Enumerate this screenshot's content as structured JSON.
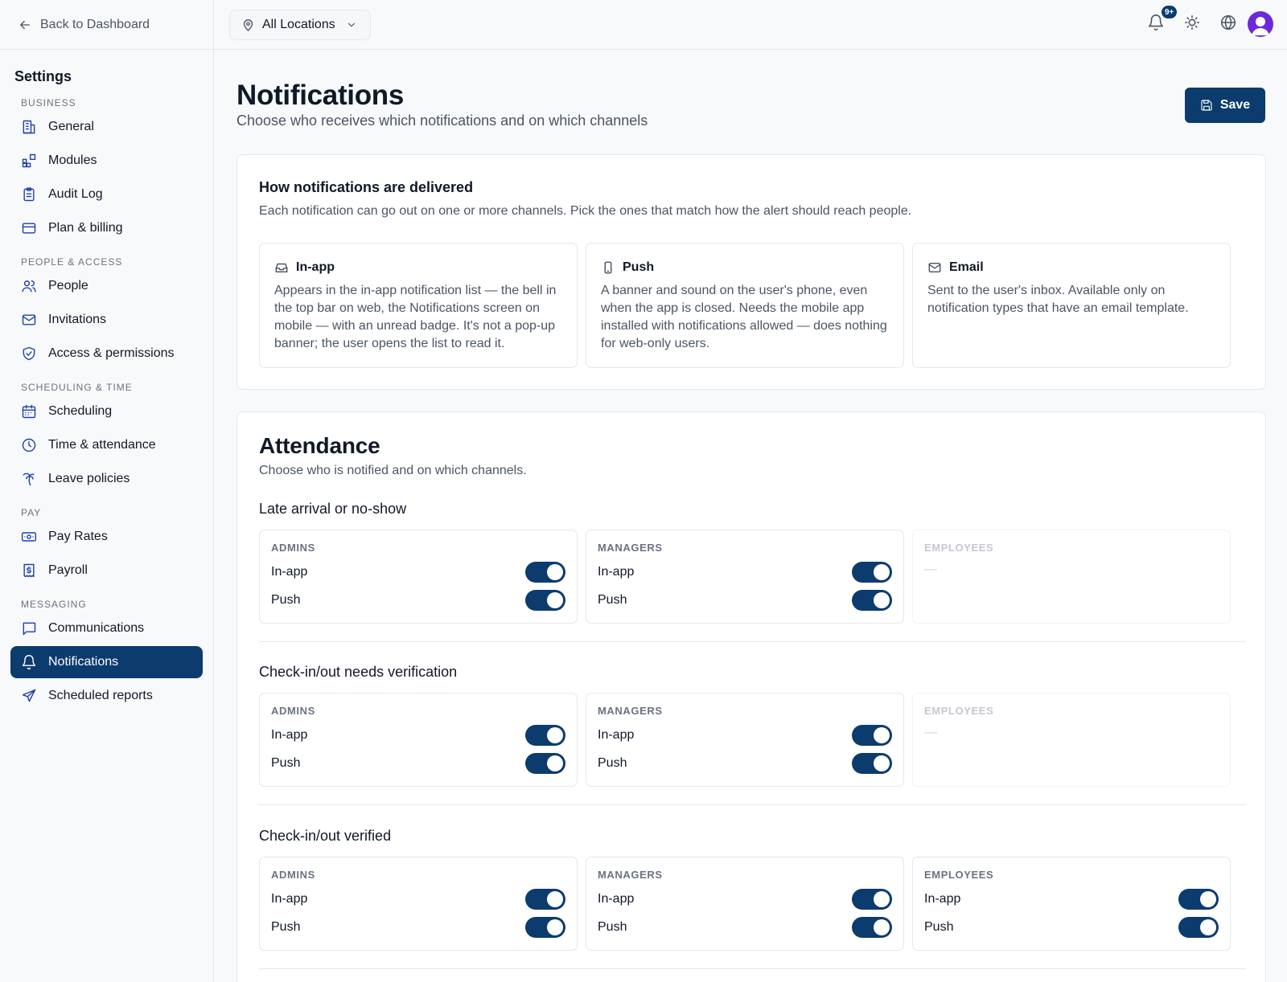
{
  "sidebar": {
    "back_label": "Back to Dashboard",
    "title": "Settings",
    "groups": [
      {
        "label": "BUSINESS",
        "items": [
          {
            "label": "General",
            "icon": "building-icon"
          },
          {
            "label": "Modules",
            "icon": "modules-icon"
          },
          {
            "label": "Audit Log",
            "icon": "clipboard-icon"
          },
          {
            "label": "Plan & billing",
            "icon": "credit-card-icon"
          }
        ]
      },
      {
        "label": "PEOPLE & ACCESS",
        "items": [
          {
            "label": "People",
            "icon": "users-icon"
          },
          {
            "label": "Invitations",
            "icon": "mail-icon"
          },
          {
            "label": "Access & permissions",
            "icon": "shield-check-icon"
          }
        ]
      },
      {
        "label": "SCHEDULING & TIME",
        "items": [
          {
            "label": "Scheduling",
            "icon": "calendar-icon"
          },
          {
            "label": "Time & attendance",
            "icon": "clock-icon"
          },
          {
            "label": "Leave policies",
            "icon": "palm-tree-icon"
          }
        ]
      },
      {
        "label": "PAY",
        "items": [
          {
            "label": "Pay Rates",
            "icon": "banknote-icon"
          },
          {
            "label": "Payroll",
            "icon": "receipt-dollar-icon"
          }
        ]
      },
      {
        "label": "MESSAGING",
        "items": [
          {
            "label": "Communications",
            "icon": "message-square-icon"
          },
          {
            "label": "Notifications",
            "icon": "bell-icon",
            "active": true
          },
          {
            "label": "Scheduled reports",
            "icon": "send-icon"
          }
        ]
      }
    ]
  },
  "topbar": {
    "location": "All Locations",
    "notification_badge": "9+"
  },
  "page": {
    "title": "Notifications",
    "subtitle": "Choose who receives which notifications and on which channels",
    "save_label": "Save"
  },
  "delivery": {
    "title": "How notifications are delivered",
    "description": "Each notification can go out on one or more channels. Pick the ones that match how the alert should reach people.",
    "channels": [
      {
        "name": "In-app",
        "icon": "inbox-icon",
        "description": "Appears in the in-app notification list — the bell in the top bar on web, the Notifications screen on mobile — with an unread badge. It's not a pop-up banner; the user opens the list to read it."
      },
      {
        "name": "Push",
        "icon": "smartphone-icon",
        "description": "A banner and sound on the user's phone, even when the app is closed. Needs the mobile app installed with notifications allowed — does nothing for web-only users."
      },
      {
        "name": "Email",
        "icon": "mail-icon",
        "description": "Sent to the user's inbox. Available only on notification types that have an email template."
      }
    ]
  },
  "attendance": {
    "title": "Attendance",
    "description": "Choose who is notified and on which channels.",
    "sections": [
      {
        "title": "Late arrival or no-show",
        "roles": [
          {
            "label": "ADMINS",
            "enabled": true,
            "toggles": [
              {
                "label": "In-app",
                "on": true
              },
              {
                "label": "Push",
                "on": true
              }
            ]
          },
          {
            "label": "MANAGERS",
            "enabled": true,
            "toggles": [
              {
                "label": "In-app",
                "on": true
              },
              {
                "label": "Push",
                "on": true
              }
            ]
          },
          {
            "label": "EMPLOYEES",
            "enabled": false,
            "empty": "—",
            "toggles": []
          }
        ]
      },
      {
        "title": "Check-in/out needs verification",
        "roles": [
          {
            "label": "ADMINS",
            "enabled": true,
            "toggles": [
              {
                "label": "In-app",
                "on": true
              },
              {
                "label": "Push",
                "on": true
              }
            ]
          },
          {
            "label": "MANAGERS",
            "enabled": true,
            "toggles": [
              {
                "label": "In-app",
                "on": true
              },
              {
                "label": "Push",
                "on": true
              }
            ]
          },
          {
            "label": "EMPLOYEES",
            "enabled": false,
            "empty": "—",
            "toggles": []
          }
        ]
      },
      {
        "title": "Check-in/out verified",
        "roles": [
          {
            "label": "ADMINS",
            "enabled": true,
            "toggles": [
              {
                "label": "In-app",
                "on": true
              },
              {
                "label": "Push",
                "on": true
              }
            ]
          },
          {
            "label": "MANAGERS",
            "enabled": true,
            "toggles": [
              {
                "label": "In-app",
                "on": true
              },
              {
                "label": "Push",
                "on": true
              }
            ]
          },
          {
            "label": "EMPLOYEES",
            "enabled": true,
            "toggles": [
              {
                "label": "In-app",
                "on": true
              },
              {
                "label": "Push",
                "on": true
              }
            ]
          }
        ]
      }
    ]
  },
  "colors": {
    "accent": "#0c3b6e",
    "icon_blue": "#1e40af",
    "avatar": "#6d28d9"
  }
}
